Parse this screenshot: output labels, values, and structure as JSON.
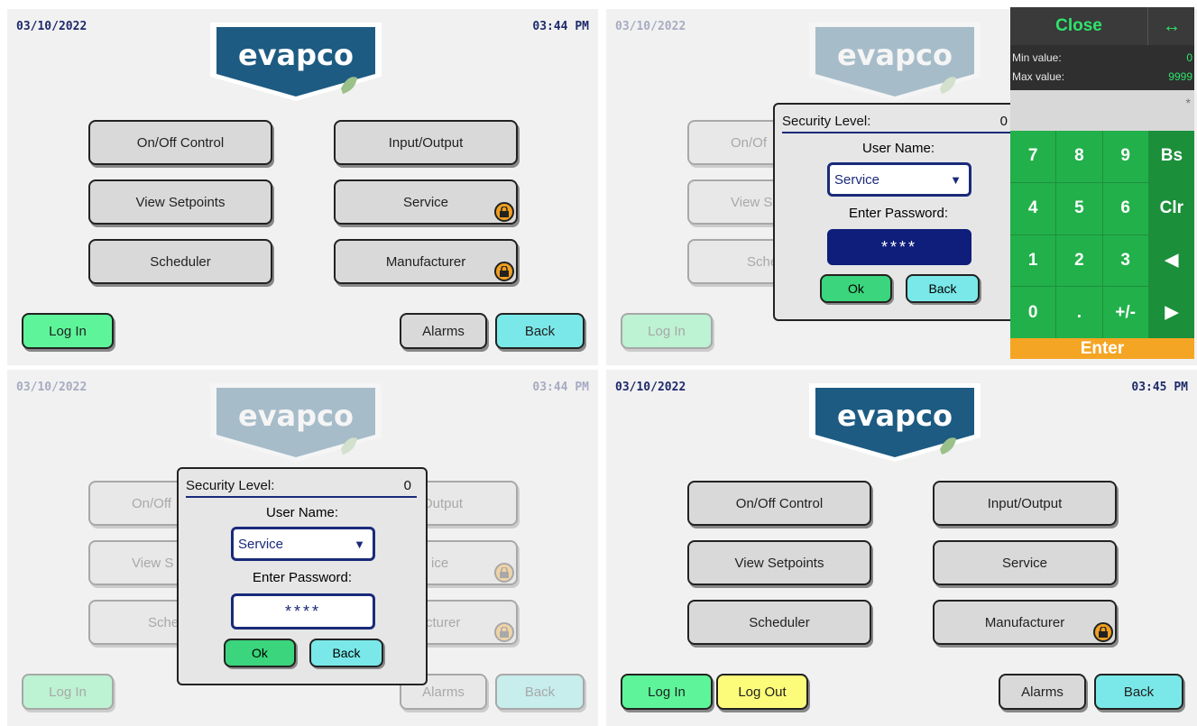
{
  "common": {
    "date": "03/10/2022",
    "brand": "evapco",
    "menu": {
      "onoff": "On/Off Control",
      "io": "Input/Output",
      "setpoints": "View Setpoints",
      "service": "Service",
      "scheduler": "Scheduler",
      "manufacturer": "Manufacturer"
    },
    "login": "Log In",
    "logout": "Log Out",
    "alarms": "Alarms",
    "back": "Back"
  },
  "panel1": {
    "time": "03:44 PM"
  },
  "panel2": {
    "dialog": {
      "security_label": "Security Level:",
      "security_value": "0",
      "user_name_label": "User Name:",
      "user_name_value": "Service",
      "enter_password_label": "Enter Password:",
      "password_mask": "****",
      "ok": "Ok",
      "back": "Back"
    },
    "partial": {
      "onoff": "On/Of",
      "setpoints": "View S",
      "scheduler": "Sche"
    },
    "keypad": {
      "close": "Close",
      "arrows": "↔",
      "min_label": "Min value:",
      "min_value": "0",
      "max_label": "Max value:",
      "max_value": "9999",
      "display": "*",
      "keys": [
        "7",
        "8",
        "9",
        "Bs",
        "4",
        "5",
        "6",
        "Clr",
        "1",
        "2",
        "3",
        "◀",
        "0",
        ".",
        "+/-",
        "▶"
      ],
      "enter": "Enter"
    }
  },
  "panel3": {
    "time": "03:44 PM",
    "dialog": {
      "security_label": "Security Level:",
      "security_value": "0",
      "user_name_label": "User Name:",
      "user_name_value": "Service",
      "enter_password_label": "Enter Password:",
      "password_mask": "****",
      "ok": "Ok",
      "back": "Back"
    },
    "partial": {
      "onoff": "On/Off",
      "io": "Output",
      "setpoints": "View S",
      "service": "ice",
      "scheduler": "Sche",
      "manufacturer": "cturer"
    }
  },
  "panel4": {
    "time": "03:45 PM"
  },
  "colors": {
    "brand_blue": "#1d5b82",
    "login_green": "#5ef59a",
    "logout_yellow": "#fdfc7a",
    "back_cyan": "#7ae8e8",
    "lock_orange": "#f0a020",
    "keypad_green": "#22b04b",
    "enter_orange": "#f5a524"
  }
}
